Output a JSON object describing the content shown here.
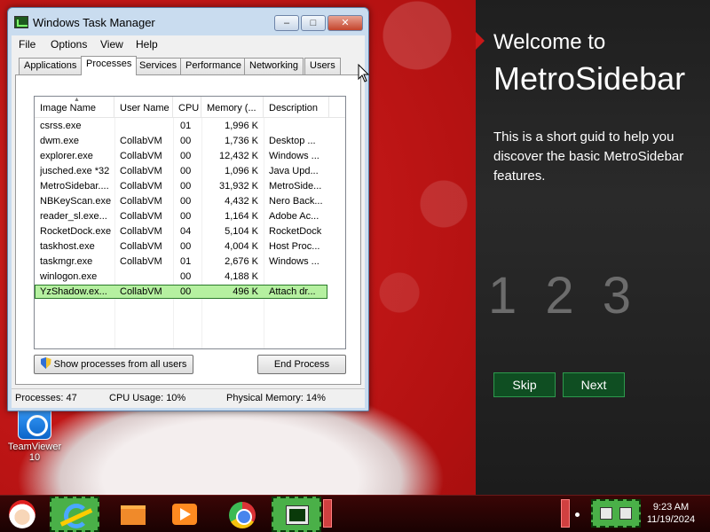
{
  "desktop": {
    "icon_label_line1": "TeamViewer",
    "icon_label_line2": "10"
  },
  "metro": {
    "welcome": "Welcome to",
    "title": "MetroSidebar",
    "description": "This is a short guid to help you discover the basic MetroSidebar features.",
    "steps": "1 2 3",
    "skip_label": "Skip",
    "next_label": "Next",
    "accent_color": "#0f4e22"
  },
  "taskmgr": {
    "title": "Windows Task Manager",
    "menu": [
      "File",
      "Options",
      "View",
      "Help"
    ],
    "tabs": [
      "Applications",
      "Processes",
      "Services",
      "Performance",
      "Networking",
      "Users"
    ],
    "active_tab": "Processes",
    "columns": [
      "Image Name",
      "User Name",
      "CPU",
      "Memory (...",
      "Description"
    ],
    "rows": [
      {
        "name": "csrss.exe",
        "user": "",
        "cpu": "01",
        "mem": "1,996 K",
        "desc": ""
      },
      {
        "name": "dwm.exe",
        "user": "CollabVM",
        "cpu": "00",
        "mem": "1,736 K",
        "desc": "Desktop ..."
      },
      {
        "name": "explorer.exe",
        "user": "CollabVM",
        "cpu": "00",
        "mem": "12,432 K",
        "desc": "Windows ..."
      },
      {
        "name": "jusched.exe *32",
        "user": "CollabVM",
        "cpu": "00",
        "mem": "1,096 K",
        "desc": "Java Upd..."
      },
      {
        "name": "MetroSidebar....",
        "user": "CollabVM",
        "cpu": "00",
        "mem": "31,932 K",
        "desc": "MetroSide..."
      },
      {
        "name": "NBKeyScan.exe",
        "user": "CollabVM",
        "cpu": "00",
        "mem": "4,432 K",
        "desc": "Nero Back..."
      },
      {
        "name": "reader_sl.exe...",
        "user": "CollabVM",
        "cpu": "00",
        "mem": "1,164 K",
        "desc": "Adobe Ac..."
      },
      {
        "name": "RocketDock.exe",
        "user": "CollabVM",
        "cpu": "04",
        "mem": "5,104 K",
        "desc": "RocketDock"
      },
      {
        "name": "taskhost.exe",
        "user": "CollabVM",
        "cpu": "00",
        "mem": "4,004 K",
        "desc": "Host Proc..."
      },
      {
        "name": "taskmgr.exe",
        "user": "CollabVM",
        "cpu": "01",
        "mem": "2,676 K",
        "desc": "Windows ..."
      },
      {
        "name": "winlogon.exe",
        "user": "",
        "cpu": "00",
        "mem": "4,188 K",
        "desc": ""
      },
      {
        "name": "YzShadow.ex...",
        "user": "CollabVM",
        "cpu": "00",
        "mem": "496 K",
        "desc": "Attach dr..."
      }
    ],
    "selected_row": 11,
    "show_all_label": "Show processes from all users",
    "end_process_label": "End Process",
    "status": {
      "processes": "Processes: 47",
      "cpu": "CPU Usage: 10%",
      "memory": "Physical Memory: 14%"
    }
  },
  "taskbar": {
    "time": "9:23 AM",
    "date": "11/19/2024"
  }
}
